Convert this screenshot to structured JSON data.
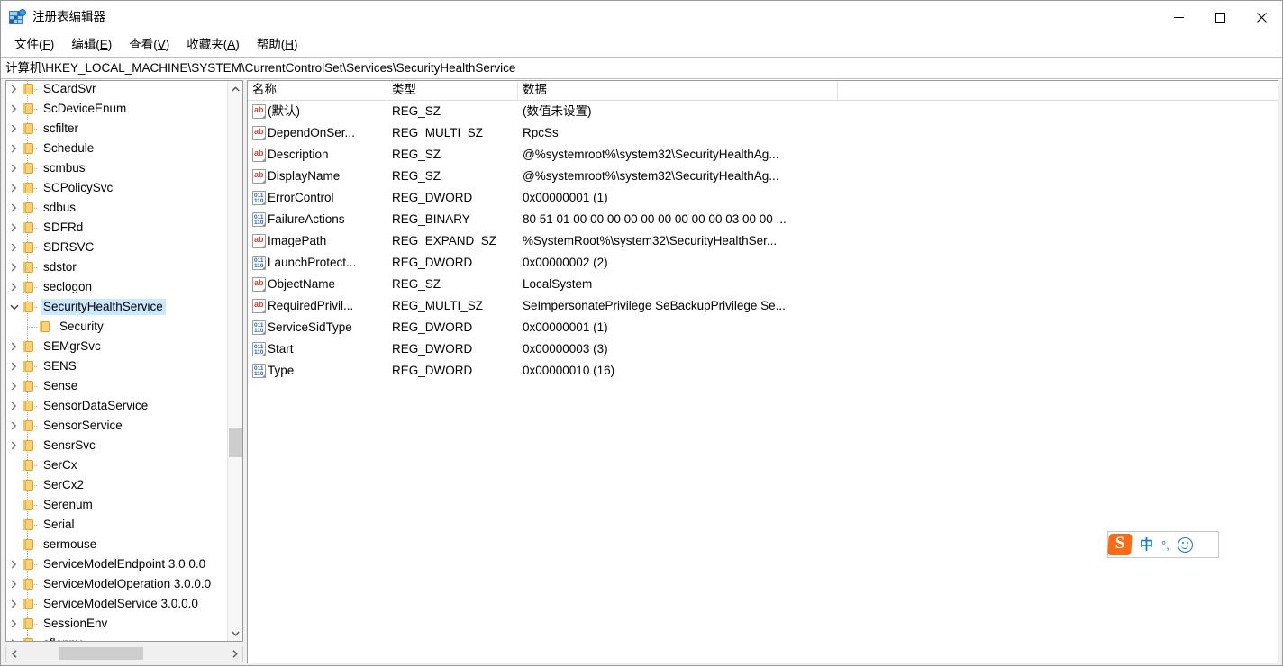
{
  "window": {
    "title": "注册表编辑器",
    "icon": "registry-editor-icon",
    "minimize_label": "—",
    "maximize_label": "□",
    "close_label": "✕"
  },
  "menubar": {
    "items": [
      {
        "label": "文件(F)",
        "text": "文件(",
        "accel": "F",
        "tail": ")"
      },
      {
        "label": "编辑(E)",
        "text": "编辑(",
        "accel": "E",
        "tail": ")"
      },
      {
        "label": "查看(V)",
        "text": "查看(",
        "accel": "V",
        "tail": ")"
      },
      {
        "label": "收藏夹(A)",
        "text": "收藏夹(",
        "accel": "A",
        "tail": ")"
      },
      {
        "label": "帮助(H)",
        "text": "帮助(",
        "accel": "H",
        "tail": ")"
      }
    ]
  },
  "address": {
    "path": "计算机\\HKEY_LOCAL_MACHINE\\SYSTEM\\CurrentControlSet\\Services\\SecurityHealthService"
  },
  "tree": {
    "selected": "SecurityHealthService",
    "items": [
      {
        "label": "SCardSvr",
        "expander": "collapsed",
        "indent": 0
      },
      {
        "label": "ScDeviceEnum",
        "expander": "collapsed",
        "indent": 0
      },
      {
        "label": "scfilter",
        "expander": "collapsed",
        "indent": 0
      },
      {
        "label": "Schedule",
        "expander": "collapsed",
        "indent": 0
      },
      {
        "label": "scmbus",
        "expander": "collapsed",
        "indent": 0
      },
      {
        "label": "SCPolicySvc",
        "expander": "collapsed",
        "indent": 0
      },
      {
        "label": "sdbus",
        "expander": "collapsed",
        "indent": 0
      },
      {
        "label": "SDFRd",
        "expander": "collapsed",
        "indent": 0
      },
      {
        "label": "SDRSVC",
        "expander": "collapsed",
        "indent": 0
      },
      {
        "label": "sdstor",
        "expander": "collapsed",
        "indent": 0
      },
      {
        "label": "seclogon",
        "expander": "collapsed",
        "indent": 0
      },
      {
        "label": "SecurityHealthService",
        "expander": "expanded",
        "indent": 0,
        "selected": true
      },
      {
        "label": "Security",
        "expander": "none",
        "indent": 1
      },
      {
        "label": "SEMgrSvc",
        "expander": "collapsed",
        "indent": 0
      },
      {
        "label": "SENS",
        "expander": "collapsed",
        "indent": 0
      },
      {
        "label": "Sense",
        "expander": "collapsed",
        "indent": 0
      },
      {
        "label": "SensorDataService",
        "expander": "collapsed",
        "indent": 0
      },
      {
        "label": "SensorService",
        "expander": "collapsed",
        "indent": 0
      },
      {
        "label": "SensrSvc",
        "expander": "collapsed",
        "indent": 0
      },
      {
        "label": "SerCx",
        "expander": "none",
        "indent": 0
      },
      {
        "label": "SerCx2",
        "expander": "none",
        "indent": 0
      },
      {
        "label": "Serenum",
        "expander": "none",
        "indent": 0
      },
      {
        "label": "Serial",
        "expander": "none",
        "indent": 0
      },
      {
        "label": "sermouse",
        "expander": "none",
        "indent": 0
      },
      {
        "label": "ServiceModelEndpoint 3.0.0.0",
        "expander": "collapsed",
        "indent": 0
      },
      {
        "label": "ServiceModelOperation 3.0.0.0",
        "expander": "collapsed",
        "indent": 0
      },
      {
        "label": "ServiceModelService 3.0.0.0",
        "expander": "collapsed",
        "indent": 0
      },
      {
        "label": "SessionEnv",
        "expander": "collapsed",
        "indent": 0
      },
      {
        "label": "sfloppy",
        "expander": "collapsed",
        "indent": 0
      }
    ]
  },
  "list": {
    "columns": [
      {
        "label": "名称"
      },
      {
        "label": "类型"
      },
      {
        "label": "数据"
      }
    ],
    "rows": [
      {
        "icon": "string-value-icon",
        "name": "(默认)",
        "type": "REG_SZ",
        "data": "(数值未设置)"
      },
      {
        "icon": "string-value-icon",
        "name": "DependOnSer...",
        "type": "REG_MULTI_SZ",
        "data": "RpcSs"
      },
      {
        "icon": "string-value-icon",
        "name": "Description",
        "type": "REG_SZ",
        "data": "@%systemroot%\\system32\\SecurityHealthAg..."
      },
      {
        "icon": "string-value-icon",
        "name": "DisplayName",
        "type": "REG_SZ",
        "data": "@%systemroot%\\system32\\SecurityHealthAg..."
      },
      {
        "icon": "binary-value-icon",
        "name": "ErrorControl",
        "type": "REG_DWORD",
        "data": "0x00000001 (1)"
      },
      {
        "icon": "binary-value-icon",
        "name": "FailureActions",
        "type": "REG_BINARY",
        "data": "80 51 01 00 00 00 00 00 00 00 00 00 03 00 00 ..."
      },
      {
        "icon": "string-value-icon",
        "name": "ImagePath",
        "type": "REG_EXPAND_SZ",
        "data": "%SystemRoot%\\system32\\SecurityHealthSer..."
      },
      {
        "icon": "binary-value-icon",
        "name": "LaunchProtect...",
        "type": "REG_DWORD",
        "data": "0x00000002 (2)"
      },
      {
        "icon": "string-value-icon",
        "name": "ObjectName",
        "type": "REG_SZ",
        "data": "LocalSystem"
      },
      {
        "icon": "string-value-icon",
        "name": "RequiredPrivil...",
        "type": "REG_MULTI_SZ",
        "data": "SeImpersonatePrivilege SeBackupPrivilege Se..."
      },
      {
        "icon": "binary-value-icon",
        "name": "ServiceSidType",
        "type": "REG_DWORD",
        "data": "0x00000001 (1)"
      },
      {
        "icon": "binary-value-icon",
        "name": "Start",
        "type": "REG_DWORD",
        "data": "0x00000003 (3)"
      },
      {
        "icon": "binary-value-icon",
        "name": "Type",
        "type": "REG_DWORD",
        "data": "0x00000010 (16)"
      }
    ]
  },
  "ime": {
    "logo_text": "S",
    "mode": "中",
    "punctuation": "°,",
    "emoji_icon": "smiley-icon"
  },
  "colors": {
    "selection": "#cce8ff",
    "folder": "#fbd277",
    "string_icon": "#d8442c",
    "binary_icon": "#2a5fb8",
    "ime_orange": "#fb6a17",
    "ime_blue": "#1b72c6"
  }
}
